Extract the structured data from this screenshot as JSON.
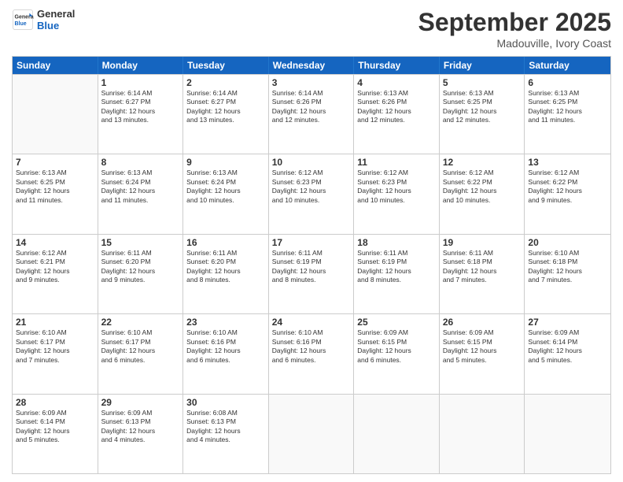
{
  "logo": {
    "line1": "General",
    "line2": "Blue"
  },
  "title": "September 2025",
  "location": "Madouville, Ivory Coast",
  "weekdays": [
    "Sunday",
    "Monday",
    "Tuesday",
    "Wednesday",
    "Thursday",
    "Friday",
    "Saturday"
  ],
  "rows": [
    [
      {
        "day": "",
        "info": ""
      },
      {
        "day": "1",
        "info": "Sunrise: 6:14 AM\nSunset: 6:27 PM\nDaylight: 12 hours\nand 13 minutes."
      },
      {
        "day": "2",
        "info": "Sunrise: 6:14 AM\nSunset: 6:27 PM\nDaylight: 12 hours\nand 13 minutes."
      },
      {
        "day": "3",
        "info": "Sunrise: 6:14 AM\nSunset: 6:26 PM\nDaylight: 12 hours\nand 12 minutes."
      },
      {
        "day": "4",
        "info": "Sunrise: 6:13 AM\nSunset: 6:26 PM\nDaylight: 12 hours\nand 12 minutes."
      },
      {
        "day": "5",
        "info": "Sunrise: 6:13 AM\nSunset: 6:25 PM\nDaylight: 12 hours\nand 12 minutes."
      },
      {
        "day": "6",
        "info": "Sunrise: 6:13 AM\nSunset: 6:25 PM\nDaylight: 12 hours\nand 11 minutes."
      }
    ],
    [
      {
        "day": "7",
        "info": "Sunrise: 6:13 AM\nSunset: 6:25 PM\nDaylight: 12 hours\nand 11 minutes."
      },
      {
        "day": "8",
        "info": "Sunrise: 6:13 AM\nSunset: 6:24 PM\nDaylight: 12 hours\nand 11 minutes."
      },
      {
        "day": "9",
        "info": "Sunrise: 6:13 AM\nSunset: 6:24 PM\nDaylight: 12 hours\nand 10 minutes."
      },
      {
        "day": "10",
        "info": "Sunrise: 6:12 AM\nSunset: 6:23 PM\nDaylight: 12 hours\nand 10 minutes."
      },
      {
        "day": "11",
        "info": "Sunrise: 6:12 AM\nSunset: 6:23 PM\nDaylight: 12 hours\nand 10 minutes."
      },
      {
        "day": "12",
        "info": "Sunrise: 6:12 AM\nSunset: 6:22 PM\nDaylight: 12 hours\nand 10 minutes."
      },
      {
        "day": "13",
        "info": "Sunrise: 6:12 AM\nSunset: 6:22 PM\nDaylight: 12 hours\nand 9 minutes."
      }
    ],
    [
      {
        "day": "14",
        "info": "Sunrise: 6:12 AM\nSunset: 6:21 PM\nDaylight: 12 hours\nand 9 minutes."
      },
      {
        "day": "15",
        "info": "Sunrise: 6:11 AM\nSunset: 6:20 PM\nDaylight: 12 hours\nand 9 minutes."
      },
      {
        "day": "16",
        "info": "Sunrise: 6:11 AM\nSunset: 6:20 PM\nDaylight: 12 hours\nand 8 minutes."
      },
      {
        "day": "17",
        "info": "Sunrise: 6:11 AM\nSunset: 6:19 PM\nDaylight: 12 hours\nand 8 minutes."
      },
      {
        "day": "18",
        "info": "Sunrise: 6:11 AM\nSunset: 6:19 PM\nDaylight: 12 hours\nand 8 minutes."
      },
      {
        "day": "19",
        "info": "Sunrise: 6:11 AM\nSunset: 6:18 PM\nDaylight: 12 hours\nand 7 minutes."
      },
      {
        "day": "20",
        "info": "Sunrise: 6:10 AM\nSunset: 6:18 PM\nDaylight: 12 hours\nand 7 minutes."
      }
    ],
    [
      {
        "day": "21",
        "info": "Sunrise: 6:10 AM\nSunset: 6:17 PM\nDaylight: 12 hours\nand 7 minutes."
      },
      {
        "day": "22",
        "info": "Sunrise: 6:10 AM\nSunset: 6:17 PM\nDaylight: 12 hours\nand 6 minutes."
      },
      {
        "day": "23",
        "info": "Sunrise: 6:10 AM\nSunset: 6:16 PM\nDaylight: 12 hours\nand 6 minutes."
      },
      {
        "day": "24",
        "info": "Sunrise: 6:10 AM\nSunset: 6:16 PM\nDaylight: 12 hours\nand 6 minutes."
      },
      {
        "day": "25",
        "info": "Sunrise: 6:09 AM\nSunset: 6:15 PM\nDaylight: 12 hours\nand 6 minutes."
      },
      {
        "day": "26",
        "info": "Sunrise: 6:09 AM\nSunset: 6:15 PM\nDaylight: 12 hours\nand 5 minutes."
      },
      {
        "day": "27",
        "info": "Sunrise: 6:09 AM\nSunset: 6:14 PM\nDaylight: 12 hours\nand 5 minutes."
      }
    ],
    [
      {
        "day": "28",
        "info": "Sunrise: 6:09 AM\nSunset: 6:14 PM\nDaylight: 12 hours\nand 5 minutes."
      },
      {
        "day": "29",
        "info": "Sunrise: 6:09 AM\nSunset: 6:13 PM\nDaylight: 12 hours\nand 4 minutes."
      },
      {
        "day": "30",
        "info": "Sunrise: 6:08 AM\nSunset: 6:13 PM\nDaylight: 12 hours\nand 4 minutes."
      },
      {
        "day": "",
        "info": ""
      },
      {
        "day": "",
        "info": ""
      },
      {
        "day": "",
        "info": ""
      },
      {
        "day": "",
        "info": ""
      }
    ]
  ]
}
